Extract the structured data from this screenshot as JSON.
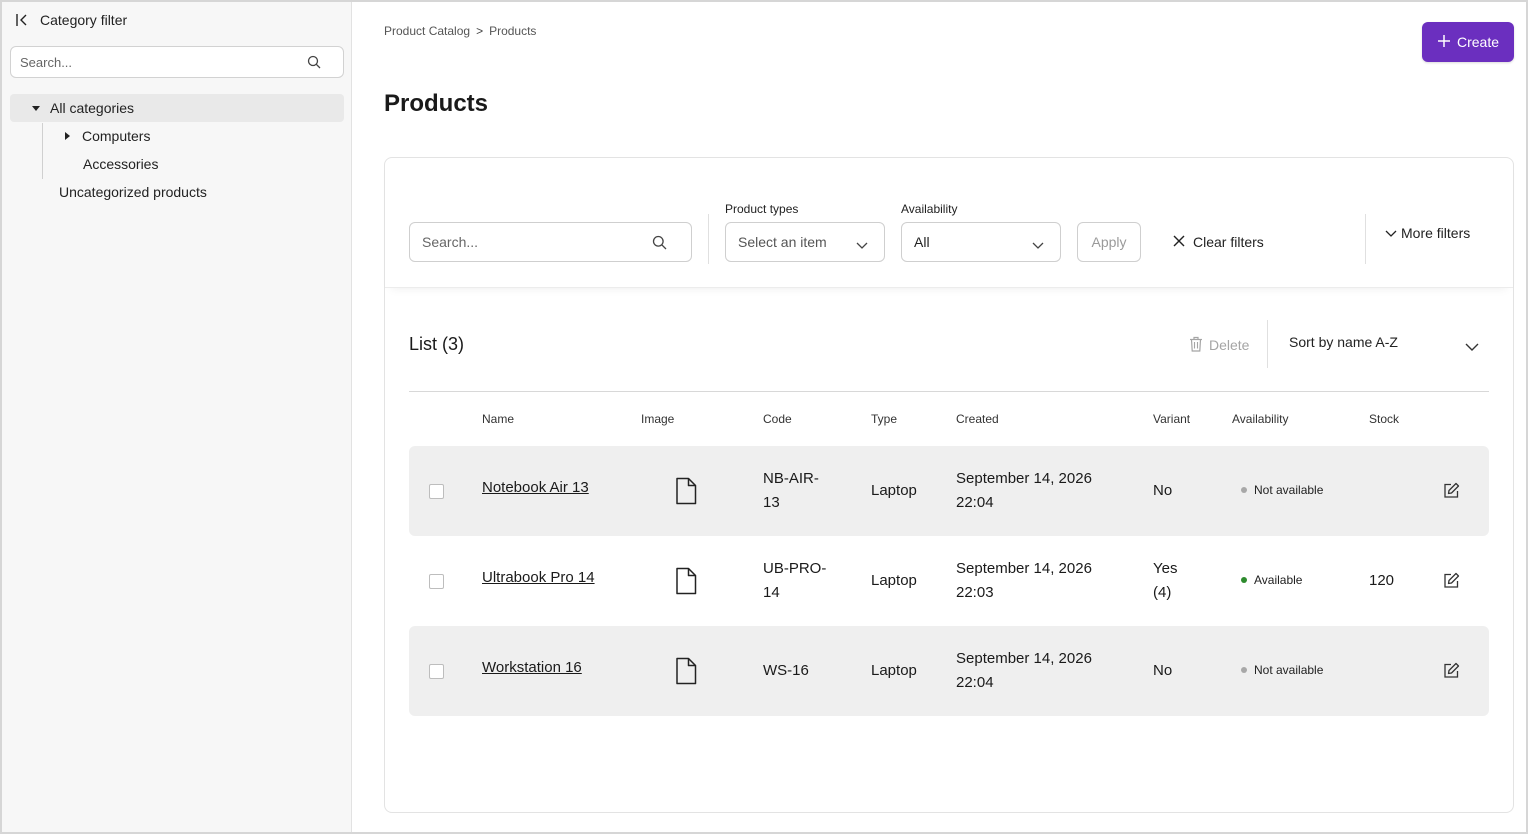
{
  "sidebar": {
    "title": "Category filter",
    "search_placeholder": "Search...",
    "tree": {
      "all": "All categories",
      "computers": "Computers",
      "accessories": "Accessories",
      "uncategorized": "Uncategorized products"
    }
  },
  "header": {
    "breadcrumb": [
      "Product Catalog",
      ">",
      "Products"
    ],
    "create_label": "Create",
    "page_title": "Products"
  },
  "filters": {
    "search_placeholder": "Search...",
    "product_types_label": "Product types",
    "product_types_value": "Select an item",
    "availability_label": "Availability",
    "availability_value": "All",
    "apply_label": "Apply",
    "clear_label": "Clear filters",
    "more_label": "More filters"
  },
  "list": {
    "title": "List (3)",
    "delete_label": "Delete",
    "sort_value": "Sort by name A-Z",
    "columns": [
      "Name",
      "Image",
      "Code",
      "Type",
      "Created",
      "Variant",
      "Availability",
      "Stock"
    ],
    "rows": [
      {
        "name": "Notebook Air 13",
        "code_line1": "NB-AIR-",
        "code_line2": "13",
        "type": "Laptop",
        "created_line1": "September 14, 2026",
        "created_line2": "22:04",
        "variant_line1": "No",
        "variant_line2": "",
        "availability": "Not available",
        "availability_color": "#a8a8a8",
        "stock": ""
      },
      {
        "name": "Ultrabook Pro 14",
        "code_line1": "UB-PRO-",
        "code_line2": "14",
        "type": "Laptop",
        "created_line1": "September 14, 2026",
        "created_line2": "22:03",
        "variant_line1": "Yes",
        "variant_line2": "(4)",
        "availability": "Available",
        "availability_color": "#2e8b2e",
        "stock": "120"
      },
      {
        "name": "Workstation 16",
        "code_line1": "WS-16",
        "code_line2": "",
        "type": "Laptop",
        "created_line1": "September 14, 2026",
        "created_line2": "22:04",
        "variant_line1": "No",
        "variant_line2": "",
        "availability": "Not available",
        "availability_color": "#a8a8a8",
        "stock": ""
      }
    ]
  },
  "colors": {
    "accent": "#6b2fbf",
    "available": "#2e8b2e",
    "unavailable": "#a8a8a8"
  }
}
